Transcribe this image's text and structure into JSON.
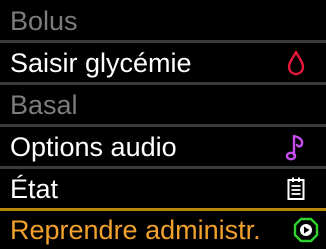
{
  "menu": {
    "items": [
      {
        "label": "Bolus",
        "state": "disabled",
        "icon": ""
      },
      {
        "label": "Saisir glycémie",
        "state": "enabled",
        "icon": "blood-drop-icon",
        "icon_color": "#e6183a"
      },
      {
        "label": "Basal",
        "state": "disabled",
        "icon": ""
      },
      {
        "label": "Options audio",
        "state": "enabled",
        "icon": "music-note-icon",
        "icon_color": "#c84cf0"
      },
      {
        "label": "État",
        "state": "enabled",
        "icon": "status-list-icon",
        "icon_color": "#ffffff"
      },
      {
        "label": "Reprendre administr.",
        "state": "selected",
        "icon": "play-circle-icon",
        "icon_color": "#2fd12f"
      }
    ]
  },
  "colors": {
    "background": "#000000",
    "text": "#ffffff",
    "disabled_text": "#7c7c7c",
    "selected_text": "#f2a12c",
    "separator": "#3a3a3a",
    "selected_separator": "#b8860b"
  }
}
